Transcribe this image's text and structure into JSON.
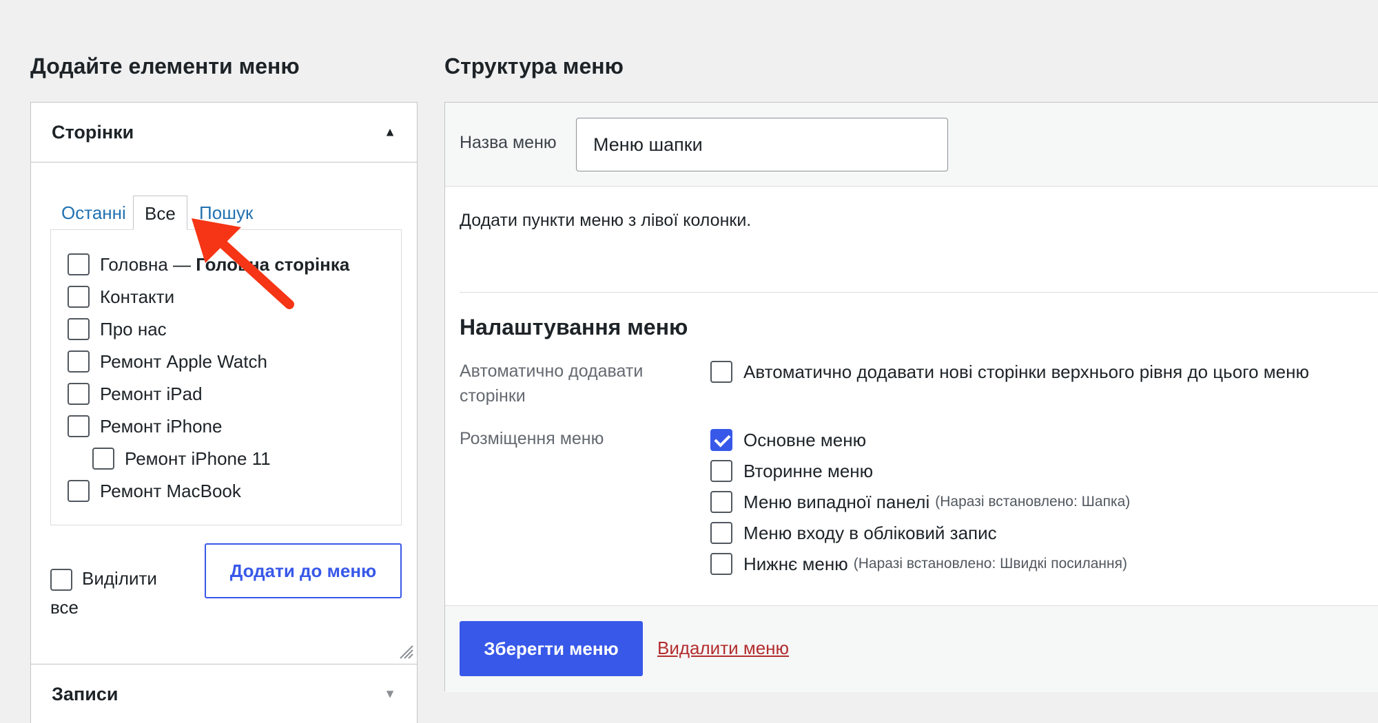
{
  "left_heading": "Додайте елементи меню",
  "right_heading": "Структура меню",
  "pages_section": {
    "title": "Сторінки",
    "tabs": [
      {
        "label": "Останні",
        "active": false
      },
      {
        "label": "Все",
        "active": true
      },
      {
        "label": "Пошук",
        "active": false
      }
    ],
    "items": [
      {
        "label": "Головна — ",
        "label_bold": "Головна сторінка",
        "checked": false,
        "indent": 0
      },
      {
        "label": "Контакти",
        "checked": false,
        "indent": 0
      },
      {
        "label": "Про нас",
        "checked": false,
        "indent": 0
      },
      {
        "label": "Ремонт Apple Watch",
        "checked": false,
        "indent": 0
      },
      {
        "label": "Ремонт iPad",
        "checked": false,
        "indent": 0
      },
      {
        "label": "Ремонт iPhone",
        "checked": false,
        "indent": 0
      },
      {
        "label": "Ремонт iPhone 11",
        "checked": false,
        "indent": 1
      },
      {
        "label": "Ремонт MacBook",
        "checked": false,
        "indent": 0
      }
    ],
    "select_all_label": "Виділити все",
    "add_button": "Додати до меню"
  },
  "posts_section": {
    "title": "Записи"
  },
  "menu_name_label": "Назва меню",
  "menu_name_value": "Меню шапки",
  "instruction": "Додати пункти меню з лівої колонки.",
  "settings_title": "Налаштування меню",
  "auto_add": {
    "label": "Автоматично додавати сторінки",
    "option": "Автоматично додавати нові сторінки верхнього рівня до цього меню",
    "checked": false
  },
  "locations": {
    "label": "Розміщення меню",
    "options": [
      {
        "label": "Основне меню",
        "note": "",
        "checked": true
      },
      {
        "label": "Вторинне меню",
        "note": "",
        "checked": false
      },
      {
        "label": "Меню випадної панелі",
        "note": "(Наразі встановлено: Шапка)",
        "checked": false
      },
      {
        "label": "Меню входу в обліковий запис",
        "note": "",
        "checked": false
      },
      {
        "label": "Нижнє меню",
        "note": "(Наразі встановлено: Швидкі посилання)",
        "checked": false
      }
    ]
  },
  "save_button": "Зберегти меню",
  "delete_link": "Видалити меню",
  "colors": {
    "accent": "#3858e9",
    "delete": "#b32d2e",
    "annotation_arrow": "#f53515"
  },
  "icons": {
    "expanded": "triangle-up",
    "collapsed": "triangle-down",
    "annotation": "red-arrow"
  }
}
